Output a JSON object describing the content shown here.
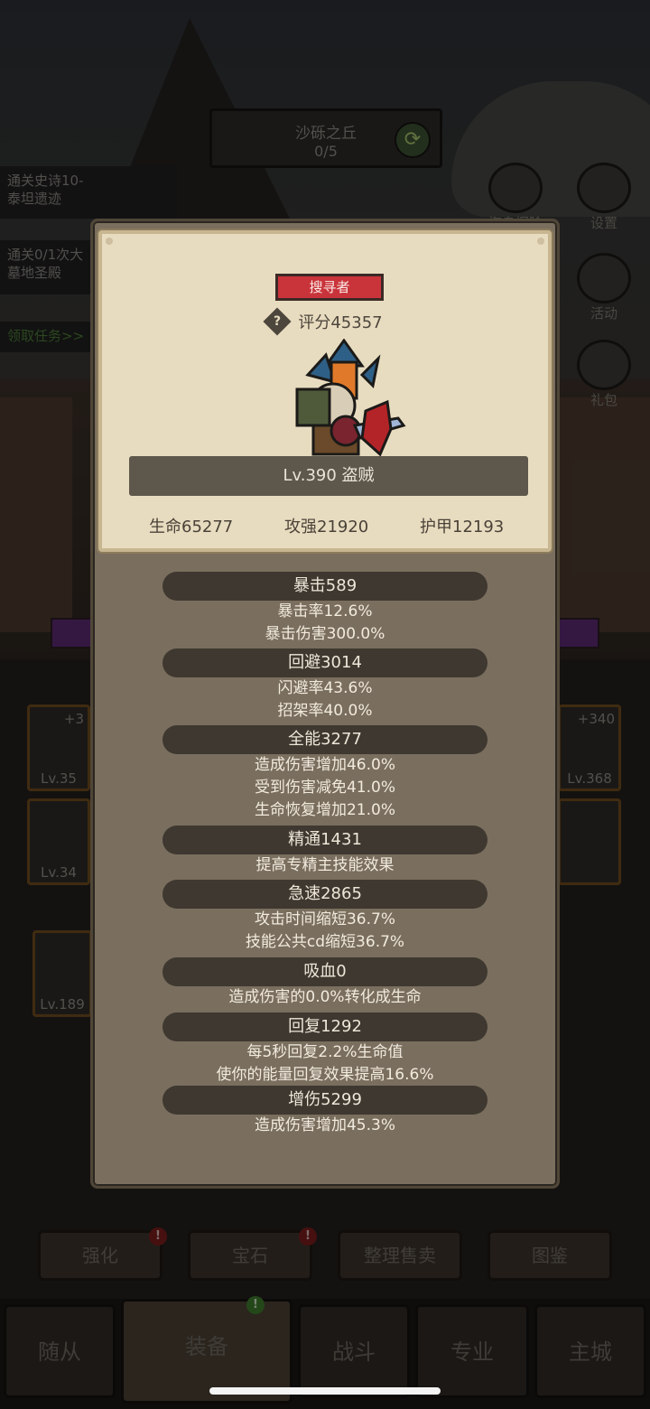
{
  "background": {
    "quest_title": "沙砾之丘",
    "quest_progress": "0/5",
    "tasks": [
      {
        "line1": "通关史诗10-",
        "line2": "泰坦遗迹"
      },
      {
        "line1": "通关0/1次大",
        "line2": "墓地圣殿"
      }
    ],
    "claim_task": "领取任务>>",
    "side_icons": [
      {
        "label": "海岛探险",
        "icon": "anchor-icon"
      },
      {
        "label": "设置",
        "icon": "gear-icon"
      },
      {
        "label": "活动",
        "icon": "scroll-icon"
      },
      {
        "label": "礼包",
        "icon": "gift-icon"
      }
    ],
    "equipment_slots": [
      {
        "plus": "+3",
        "level": "Lv.35"
      },
      {
        "plus": "+340",
        "level": "Lv.368"
      },
      {
        "plus": "",
        "level": "Lv.34"
      },
      {
        "plus": "",
        "level": ""
      }
    ],
    "inventory_item_level": "Lv.189",
    "bottom_buttons": [
      "强化",
      "宝石",
      "整理售卖",
      "图鉴"
    ],
    "badges": [
      "!",
      "!",
      "!"
    ],
    "nav_tabs": [
      "随从",
      "装备",
      "战斗",
      "专业",
      "主城"
    ]
  },
  "dialog": {
    "role_tag": "搜寻者",
    "score_label": "评分45357",
    "help_icon_text": "?",
    "level_label": "Lv.390 盗贼",
    "stats": {
      "hp": "生命65277",
      "attack": "攻强21920",
      "armor": "护甲12193"
    },
    "sections": [
      {
        "title": "暴击589",
        "lines": [
          "暴击率12.6%",
          "暴击伤害300.0%"
        ]
      },
      {
        "title": "回避3014",
        "lines": [
          "闪避率43.6%",
          "招架率40.0%"
        ]
      },
      {
        "title": "全能3277",
        "lines": [
          "造成伤害增加46.0%",
          "受到伤害减免41.0%",
          "生命恢复增加21.0%"
        ]
      },
      {
        "title": "精通1431",
        "lines": [
          "提高专精主技能效果"
        ]
      },
      {
        "title": "急速2865",
        "lines": [
          "攻击时间缩短36.7%",
          "技能公共cd缩短36.7%"
        ]
      },
      {
        "title": "吸血0",
        "lines": [
          "造成伤害的0.0%转化成生命"
        ]
      },
      {
        "title": "回复1292",
        "lines": [
          "每5秒回复2.2%生命值",
          "使你的能量回复效果提高16.6%"
        ]
      },
      {
        "title": "增伤5299",
        "lines": [
          "造成伤害增加45.3%"
        ]
      }
    ]
  }
}
